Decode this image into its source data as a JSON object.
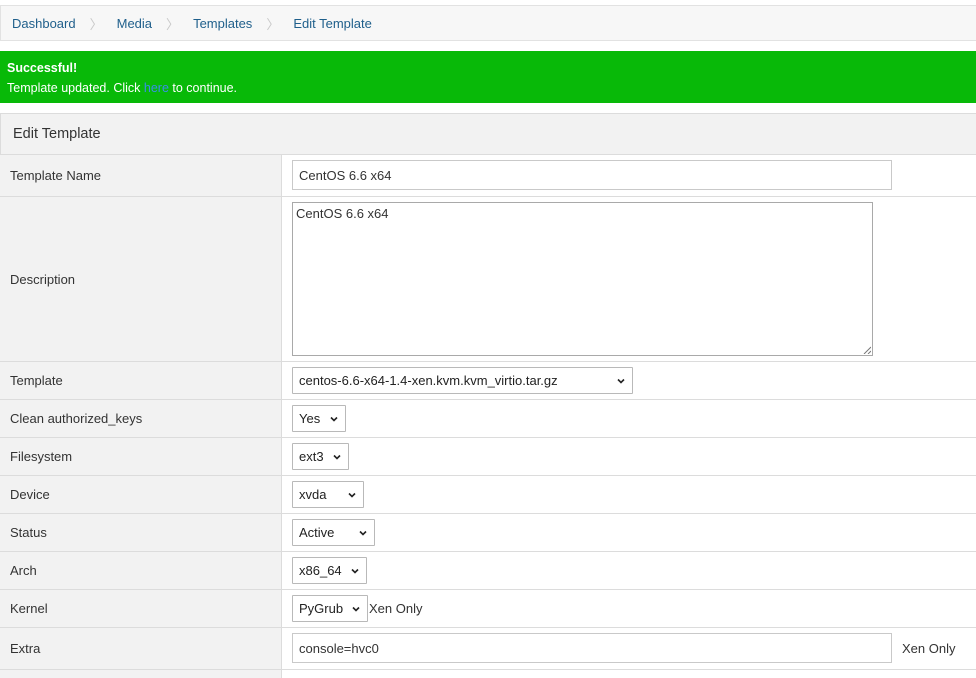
{
  "breadcrumb": {
    "items": [
      {
        "label": "Dashboard"
      },
      {
        "label": "Media"
      },
      {
        "label": "Templates"
      },
      {
        "label": "Edit Template"
      }
    ]
  },
  "alert": {
    "title": "Successful!",
    "message_before": "Template updated. Click ",
    "link": "here",
    "message_after": " to continue.",
    "color": "#08b908"
  },
  "panel": {
    "title": "Edit Template"
  },
  "form": {
    "template_name": {
      "label": "Template Name",
      "value": "CentOS 6.6 x64"
    },
    "description": {
      "label": "Description",
      "value": "CentOS 6.6 x64"
    },
    "template": {
      "label": "Template",
      "selected": "centos-6.6-x64-1.4-xen.kvm.kvm_virtio.tar.gz"
    },
    "clean_keys": {
      "label": "Clean authorized_keys",
      "selected": "Yes"
    },
    "filesystem": {
      "label": "Filesystem",
      "selected": "ext3"
    },
    "device": {
      "label": "Device",
      "selected": "xvda"
    },
    "status": {
      "label": "Status",
      "selected": "Active"
    },
    "arch": {
      "label": "Arch",
      "selected": "x86_64"
    },
    "kernel": {
      "label": "Kernel",
      "selected": "PyGrub",
      "note": "Xen Only"
    },
    "extra": {
      "label": "Extra",
      "value": "console=hvc0",
      "note": "Xen Only"
    }
  }
}
